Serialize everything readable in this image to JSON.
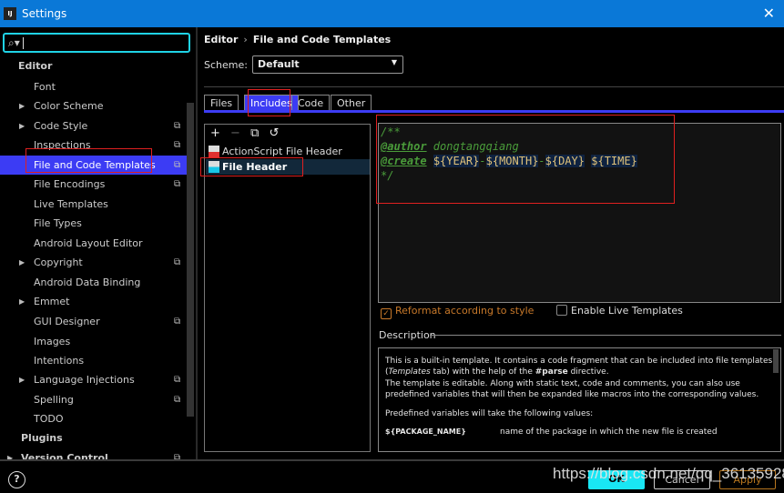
{
  "window": {
    "title": "Settings",
    "close_icon": "close-icon"
  },
  "search": {
    "value": "",
    "placeholder": ""
  },
  "sidebar": {
    "items": [
      {
        "label": "Editor",
        "level": 0
      },
      {
        "label": "Font"
      },
      {
        "label": "Color Scheme",
        "expandable": true
      },
      {
        "label": "Code Style",
        "expandable": true,
        "project": true
      },
      {
        "label": "Inspections",
        "project": true
      },
      {
        "label": "File and Code Templates",
        "project": true,
        "selected": true
      },
      {
        "label": "File Encodings",
        "project": true
      },
      {
        "label": "Live Templates"
      },
      {
        "label": "File Types"
      },
      {
        "label": "Android Layout Editor"
      },
      {
        "label": "Copyright",
        "expandable": true,
        "project": true
      },
      {
        "label": "Android Data Binding"
      },
      {
        "label": "Emmet",
        "expandable": true
      },
      {
        "label": "GUI Designer",
        "project": true
      },
      {
        "label": "Images"
      },
      {
        "label": "Intentions"
      },
      {
        "label": "Language Injections",
        "expandable": true,
        "project": true
      },
      {
        "label": "Spelling",
        "project": true
      },
      {
        "label": "TODO"
      },
      {
        "label": "Plugins",
        "level": 0
      },
      {
        "label": "Version Control",
        "level": 0,
        "expandable": true,
        "project": true
      }
    ]
  },
  "breadcrumb": {
    "parent": "Editor",
    "sep": "›",
    "current": "File and Code Templates"
  },
  "scheme": {
    "label": "Scheme:",
    "value": "Default"
  },
  "tabs": [
    {
      "label": "Files"
    },
    {
      "label": "Includes",
      "active": true
    },
    {
      "label": "Code"
    },
    {
      "label": "Other"
    }
  ],
  "toolbar": {
    "add": "+",
    "remove": "−",
    "copy": "⧉",
    "reset": "↺"
  },
  "templates": [
    {
      "label": "ActionScript File Header"
    },
    {
      "label": "File Header",
      "selected": true
    }
  ],
  "editor": {
    "l1": "/**",
    "author_tag": "@author",
    "author": " dongtangqiang",
    "create_tag": "@create",
    "v_year": "${YEAR}",
    "dash": "-",
    "v_month": "${MONTH}",
    "v_day": "${DAY}",
    "v_time": "${TIME}",
    "l4": "*/"
  },
  "options": {
    "reformat": {
      "label": "Reformat according to style",
      "checked": true
    },
    "live": {
      "label": "Enable Live Templates",
      "checked": false
    }
  },
  "description": {
    "label": "Description",
    "p1a": "This is a built-in template. It contains a code fragment that can be included into file templates (",
    "p1b": "Templates",
    "p1c": " tab) with the help of the ",
    "p1d": "#parse",
    "p1e": " directive.",
    "p2": "The template is editable. Along with static text, code and comments, you can also use predefined variables that will then be expanded like macros into the corresponding values.",
    "p3": "Predefined variables will take the following values:",
    "var_name": "${PACKAGE_NAME}",
    "var_desc": "name of the package in which the new file is created"
  },
  "buttons": {
    "ok": "OK",
    "cancel": "Cancel",
    "apply": "Apply",
    "help": "?"
  },
  "watermark": "https://blog.csdn.net/qq_36135928",
  "colors": {
    "accent": "#3c3cf4",
    "titlebar": "#0a78d7",
    "ok": "#19e6f4",
    "annotation": "#e02020"
  }
}
